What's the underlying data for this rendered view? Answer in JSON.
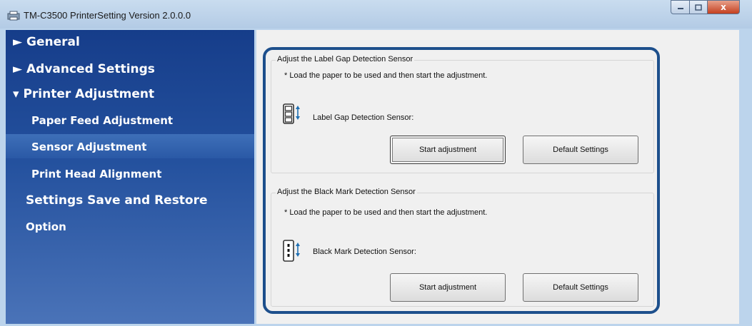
{
  "window": {
    "title": "TM-C3500 PrinterSetting Version 2.0.0.0",
    "close_glyph": "x"
  },
  "sidebar": {
    "items": [
      {
        "label": "► General"
      },
      {
        "label": "► Advanced Settings"
      },
      {
        "label": "▾ Printer Adjustment"
      },
      {
        "label": "Paper Feed Adjustment"
      },
      {
        "label": "Sensor Adjustment"
      },
      {
        "label": "Print Head Alignment"
      },
      {
        "label": "Settings Save and Restore"
      },
      {
        "label": "Option"
      }
    ],
    "selected_item": "Sensor Adjustment"
  },
  "label_gap": {
    "group_title": "Adjust the Label Gap Detection Sensor",
    "note": "* Load the paper to be used and then start the adjustment.",
    "sensor_label": "Label Gap Detection Sensor:",
    "start_button": "Start adjustment",
    "default_button": "Default Settings",
    "icon": "label-gap-sensor-icon"
  },
  "black_mark": {
    "group_title": "Adjust the Black Mark Detection Sensor",
    "note": "* Load the paper to be used and then start the adjustment.",
    "sensor_label": "Black Mark Detection Sensor:",
    "start_button": "Start adjustment",
    "default_button": "Default Settings",
    "icon": "black-mark-sensor-icon"
  },
  "colors": {
    "sidebar": "#1f4a95",
    "highlight_border": "#1d4f8c",
    "close_button": "#c4401f"
  }
}
